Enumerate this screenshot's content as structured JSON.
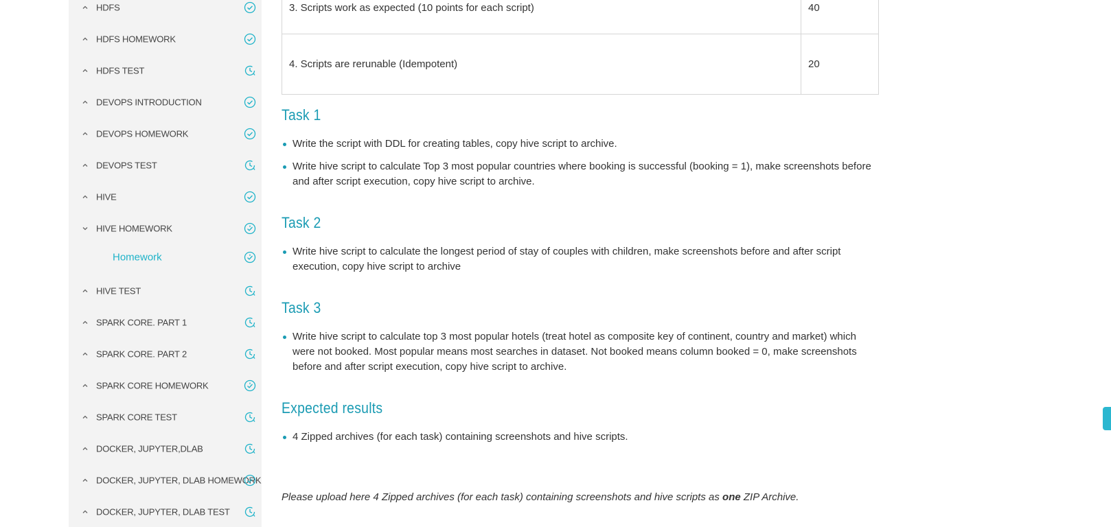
{
  "sidebar": {
    "items": [
      {
        "label": "HDFS",
        "status": "complete"
      },
      {
        "label": "HDFS HOMEWORK",
        "status": "complete"
      },
      {
        "label": "HDFS TEST",
        "status": "pending"
      },
      {
        "label": "DEVOPS INTRODUCTION",
        "status": "complete"
      },
      {
        "label": "DEVOPS HOMEWORK",
        "status": "complete"
      },
      {
        "label": "DEVOPS TEST",
        "status": "pending"
      },
      {
        "label": "HIVE",
        "status": "complete"
      },
      {
        "label": "HIVE HOMEWORK",
        "status": "in-review",
        "expanded": true
      },
      {
        "label": "Homework",
        "status": "in-review",
        "sub": true,
        "active": true
      },
      {
        "label": "HIVE TEST",
        "status": "pending"
      },
      {
        "label": "SPARK CORE. PART 1",
        "status": "pending"
      },
      {
        "label": "SPARK CORE. PART 2",
        "status": "pending"
      },
      {
        "label": "SPARK CORE HOMEWORK",
        "status": "in-review"
      },
      {
        "label": "SPARK CORE TEST",
        "status": "pending"
      },
      {
        "label": "DOCKER, JUPYTER,DLAB",
        "status": "pending"
      },
      {
        "label": "DOCKER, JUPYTER, DLAB HOMEWORK",
        "status": "in-review"
      },
      {
        "label": "DOCKER, JUPYTER, DLAB TEST",
        "status": "pending"
      }
    ]
  },
  "colors": {
    "accent": "#1fb3c9",
    "heading": "#1a9bb3",
    "sidebar_bg": "#f3f3f3"
  },
  "criteria_table": {
    "rows": [
      {
        "criterion": "3. Scripts work as expected (10 points for each script)",
        "points": "40"
      },
      {
        "criterion": "4. Scripts are rerunable (Idempotent)",
        "points": "20"
      }
    ]
  },
  "task1": {
    "title": "Task 1",
    "items": [
      "Write the script with DDL for creating tables, copy hive script to archive.",
      "Write hive script to calculate Top 3 most popular countries where booking is successful (booking = 1), make screenshots before and after script execution, copy hive script to archive."
    ]
  },
  "task2": {
    "title": "Task 2",
    "items": [
      "Write hive script to calculate the longest period of stay of couples with children, make screenshots before and after script execution, copy hive script to archive"
    ]
  },
  "task3": {
    "title": "Task 3",
    "items": [
      "Write hive script to calculate top 3 most popular hotels (treat hotel as composite key of continent, country and market) which were not booked. Most popular means most searches in dataset. Not booked means column booked = 0, make screenshots before and after script execution, copy hive script to archive."
    ]
  },
  "expected": {
    "title": "Expected results",
    "items": [
      "4 Zipped archives (for each task) containing screenshots and hive scripts."
    ]
  },
  "upload_note": {
    "before": "Please upload here 4 Zipped archives (for each task) containing screenshots and hive scripts as ",
    "bold": "one",
    "after": " ZIP Archive."
  }
}
